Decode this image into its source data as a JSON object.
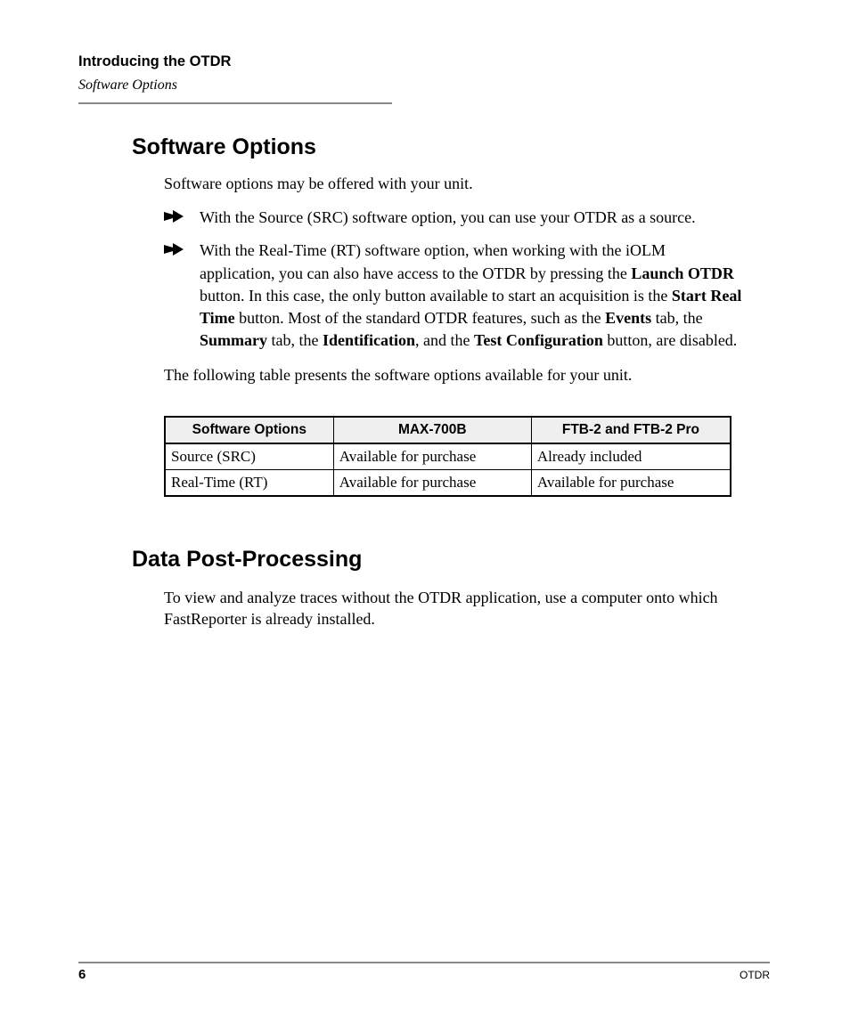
{
  "header": {
    "chapter_title": "Introducing the OTDR",
    "section_label": "Software Options"
  },
  "sections": {
    "software_options": {
      "heading": "Software Options",
      "intro": "Software options may be offered with your unit.",
      "bullets": [
        {
          "runs": [
            {
              "t": "With the Source (SRC) software option, you can use your OTDR as a source."
            }
          ]
        },
        {
          "runs": [
            {
              "t": "With the Real-Time (RT) software option, when working with the iOLM application, you can also have access to the OTDR by pressing the "
            },
            {
              "t": "Launch OTDR",
              "b": true
            },
            {
              "t": " button. In this case, the only button available to start an acquisition is the "
            },
            {
              "t": "Start Real Time",
              "b": true
            },
            {
              "t": " button. Most of the standard OTDR features, such as the "
            },
            {
              "t": "Events",
              "b": true
            },
            {
              "t": " tab, the "
            },
            {
              "t": "Summary",
              "b": true
            },
            {
              "t": " tab, the "
            },
            {
              "t": "Identification",
              "b": true
            },
            {
              "t": ", and the "
            },
            {
              "t": "Test Configuration",
              "b": true
            },
            {
              "t": " button, are disabled."
            }
          ]
        }
      ],
      "follow": "The following table presents the software options available for your unit.",
      "table": {
        "headers": [
          "Software Options",
          "MAX-700B",
          "FTB-2 and FTB-2 Pro"
        ],
        "rows": [
          [
            "Source (SRC)",
            "Available for purchase",
            "Already included"
          ],
          [
            "Real-Time (RT)",
            "Available for purchase",
            "Available for purchase"
          ]
        ]
      }
    },
    "data_post_processing": {
      "heading": "Data Post-Processing",
      "body": "To view and analyze traces without the OTDR application, use a computer onto which FastReporter is already installed."
    }
  },
  "footer": {
    "page_number": "6",
    "doc_label": "OTDR"
  }
}
